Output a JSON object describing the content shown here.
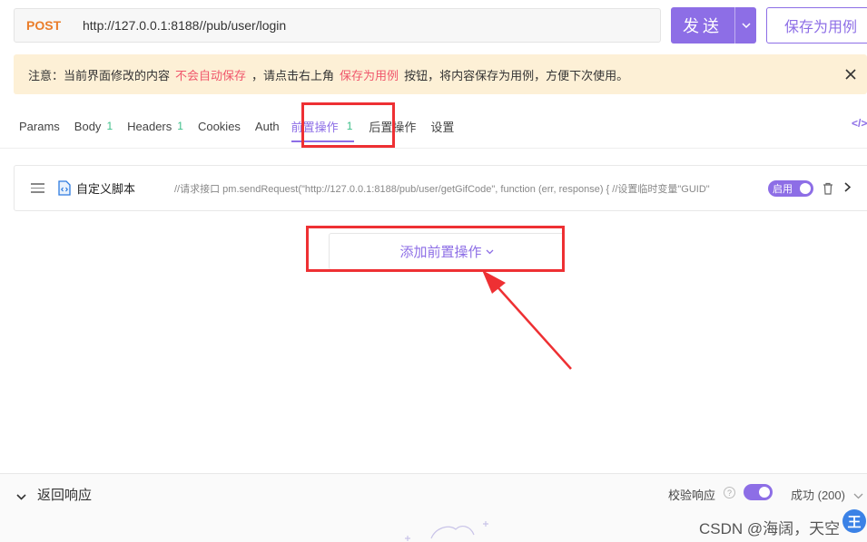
{
  "request": {
    "method": "POST",
    "url": "http://127.0.0.1:8188//pub/user/login",
    "send_label": "发送",
    "save_case_label": "保存为用例"
  },
  "notice": {
    "prefix": "注意：当前界面修改的内容",
    "highlight1": "不会自动保存",
    "middle": "，请点击右上角",
    "highlight2": "保存为用例",
    "suffix": "按钮，将内容保存为用例，方便下次使用。"
  },
  "tabs": [
    {
      "label": "Params",
      "count": ""
    },
    {
      "label": "Body",
      "count": "1"
    },
    {
      "label": "Headers",
      "count": "1"
    },
    {
      "label": "Cookies",
      "count": ""
    },
    {
      "label": "Auth",
      "count": ""
    },
    {
      "label": "前置操作",
      "count": "1"
    },
    {
      "label": "后置操作",
      "count": ""
    },
    {
      "label": "设置",
      "count": ""
    }
  ],
  "code_icon": "</>",
  "script": {
    "name": "自定义脚本",
    "preview": "//请求接口 pm.sendRequest(\"http://127.0.0.1:8188/pub/user/getGifCode\", function (err, response) { //设置临时变量\"GUID\"",
    "toggle_label": "启用"
  },
  "add_pre_label": "添加前置操作",
  "response": {
    "title": "返回响应",
    "validate_label": "校验响应",
    "help": "?",
    "status": "成功 (200)"
  },
  "watermark": "CSDN @海阔，天空",
  "watermark_badge": "王",
  "colors": {
    "accent": "#8d6ee6",
    "method": "#ea7d2a",
    "warning_text": "#f0566b",
    "notice_bg": "#fdf0d6",
    "annotation": "#ee3033"
  }
}
